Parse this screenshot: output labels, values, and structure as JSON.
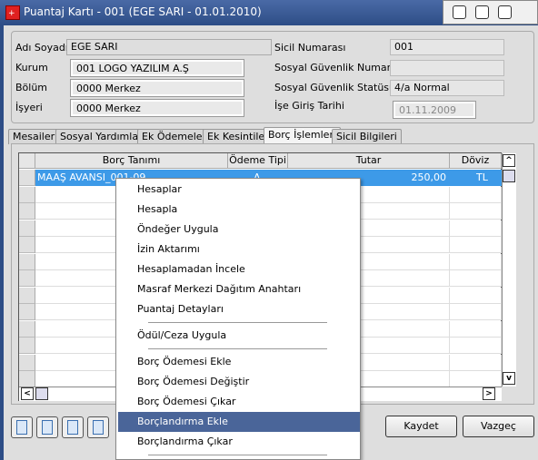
{
  "window": {
    "title": "Puantaj Kartı - 001 (EGE SARI - 01.01.2010)",
    "buttons": [
      "⌄",
      "⌃",
      "✕"
    ]
  },
  "form": {
    "left": [
      {
        "label": "Adı Soyadı",
        "value": "EGE SARI"
      },
      {
        "label": "Kurum",
        "value": "001 LOGO YAZILIM A.Ş"
      },
      {
        "label": "Bölüm",
        "value": "0000 Merkez"
      },
      {
        "label": "İşyeri",
        "value": "0000 Merkez"
      }
    ],
    "right": [
      {
        "label": "Sicil Numarası",
        "value": "001"
      },
      {
        "label": "Sosyal Güvenlik Numarası",
        "value": ""
      },
      {
        "label": "Sosyal Güvenlik Statüsü",
        "value": "4/a Normal"
      },
      {
        "label": "İşe Giriş Tarihi",
        "value": "01.11.2009"
      }
    ]
  },
  "tabs": [
    {
      "label": "Mesailer"
    },
    {
      "label": "Sosyal Yardımlar"
    },
    {
      "label": "Ek Ödemeler"
    },
    {
      "label": "Ek Kesintiler"
    },
    {
      "label": "Borç İşlemleri",
      "active": true
    },
    {
      "label": "Sicil Bilgileri"
    }
  ],
  "grid": {
    "columns": [
      "Borç Tanımı",
      "Ödeme Tipi",
      "Tutar",
      "Döviz"
    ],
    "rows": [
      {
        "borc_tanimi": "MAAŞ AVANSI_001-09",
        "odeme_tipi": "A",
        "tutar": "250,00",
        "doviz": "TL"
      }
    ]
  },
  "buttons": {
    "save": "Kaydet",
    "cancel": "Vazgeç"
  },
  "context_menu": {
    "items": [
      "Hesaplar",
      "Hesapla",
      "Öndeğer Uygula",
      "İzin Aktarımı",
      "Hesaplamadan İncele",
      "Masraf Merkezi Dağıtım Anahtarı",
      "Puantaj Detayları",
      "Ödül/Ceza Uygula",
      "Borç Ödemesi Ekle",
      "Borç Ödemesi Değiştir",
      "Borç Ödemesi Çıkar",
      "Borçlandırma Ekle",
      "Borçlandırma Çıkar"
    ],
    "highlighted": "Borçlandırma Ekle"
  },
  "colors": {
    "titlebar": "#2d4d86",
    "selection": "#3d9ae8",
    "menu_highlight": "#4a6599"
  }
}
